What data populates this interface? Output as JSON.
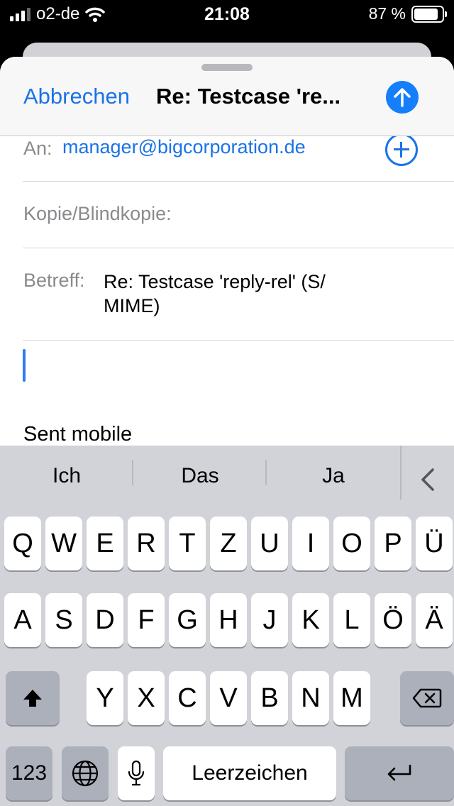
{
  "status_bar": {
    "carrier": "o2-de",
    "time": "21:08",
    "battery": "87 %",
    "battery_level": 0.87
  },
  "compose": {
    "cancel_label": "Abbrechen",
    "title": "Re: Testcase 're...",
    "to_label": "An:",
    "to_value": "manager@bigcorporation.de",
    "cc_label": "Kopie/Blindkopie:",
    "subject_label": "Betreff:",
    "subject_line1": "Re: Testcase 'reply-rel' (S/",
    "subject_line2": "MIME)",
    "signature": "Sent mobile",
    "accent_color": "#1a73e8"
  },
  "keyboard": {
    "suggestions": [
      "Ich",
      "Das",
      "Ja"
    ],
    "row1": [
      "Q",
      "W",
      "E",
      "R",
      "T",
      "Z",
      "U",
      "I",
      "O",
      "P",
      "Ü"
    ],
    "row2": [
      "A",
      "S",
      "D",
      "F",
      "G",
      "H",
      "J",
      "K",
      "L",
      "Ö",
      "Ä"
    ],
    "row3": [
      "Y",
      "X",
      "C",
      "V",
      "B",
      "N",
      "M"
    ],
    "numbers_label": "123",
    "space_label": "Leerzeichen"
  }
}
